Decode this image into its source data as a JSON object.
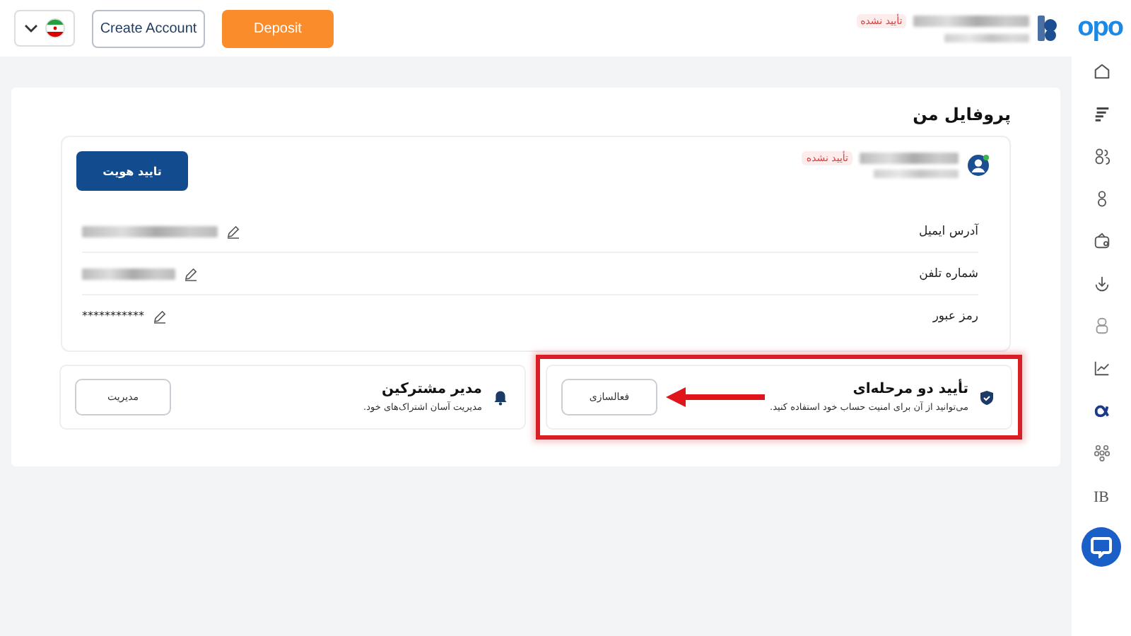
{
  "header": {
    "logo": "opo",
    "status_badge": "تأیید نشده",
    "buttons": [
      {
        "label": "Deposit",
        "kind": "primary"
      },
      {
        "label": "Create Account",
        "kind": "outline"
      }
    ]
  },
  "sidebar": {
    "ib_label": "IB"
  },
  "page_title": "پروفایل من",
  "profile": {
    "status_badge": "تأیید نشده",
    "verify_button": "تایید هویت",
    "fields": [
      {
        "label": "آدرس ایمیل",
        "kind": "masked"
      },
      {
        "label": "شماره تلفن",
        "kind": "masked"
      },
      {
        "label": "رمز عبور",
        "kind": "text",
        "value": "***********"
      }
    ]
  },
  "cards": [
    {
      "kind": "security",
      "title": "تأیید دو مرحله‌ای",
      "description": "می‌توانید از آن برای امنیت حساب خود استفاده کنید.",
      "button": "فعالسازی",
      "highlighted": true
    },
    {
      "kind": "subscription",
      "title": "مدیر مشترکین",
      "description": "مدیریت آسان اشتراک‌های خود.",
      "button": "مدیریت",
      "highlighted": false
    }
  ]
}
